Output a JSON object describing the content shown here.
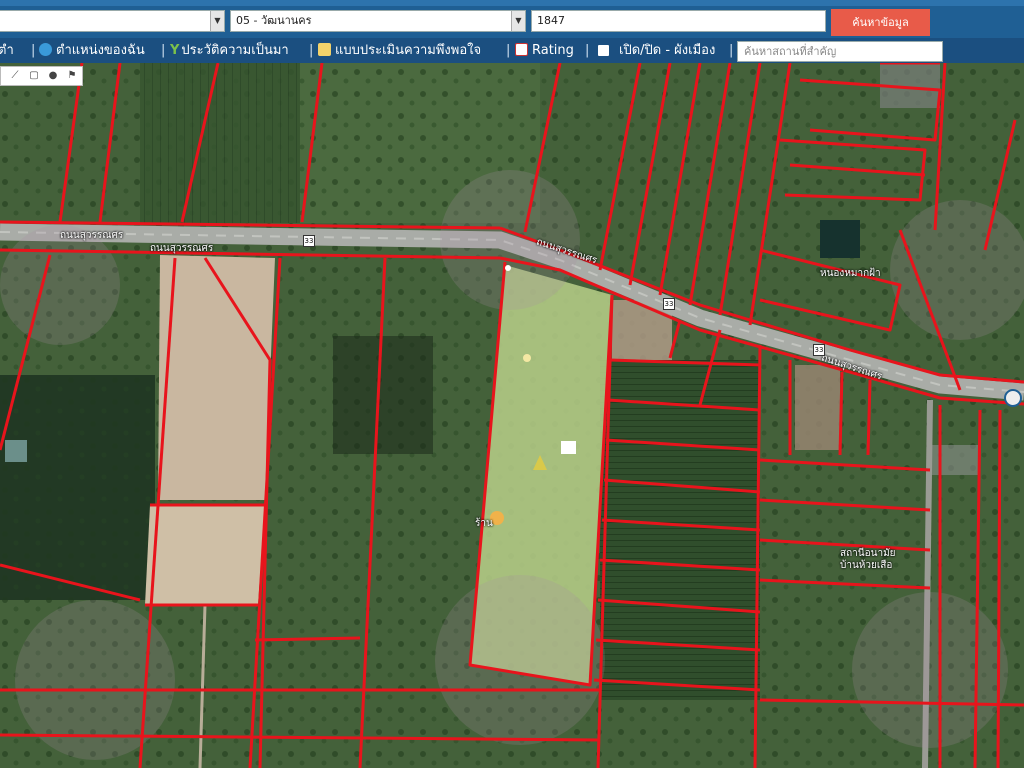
{
  "search": {
    "district_value": "",
    "subdistrict_value": "05 - วัฒนานคร",
    "parcel_value": "1847",
    "search_button": "ค้นหาข้อมูล"
  },
  "nav": {
    "item_home": "ตำ",
    "item_location": "ตำแหน่งของฉัน",
    "item_history": "ประวัติความเป็นมา",
    "item_survey": "แบบประเมินความพึงพอใจ",
    "item_rating": "Rating",
    "item_toggle": "เปิด/ปิด - ผังเมือง",
    "place_placeholder": "ค้นหาสถานที่สำคัญ"
  },
  "map": {
    "road_label_1": "ถนนสุวรรณศร",
    "road_label_2": "ถนนสุวรรณศร",
    "road_label_3": "ถนนสุวรรณศร",
    "road_number": "33",
    "place_label_1": "หนองหมากฝ้า",
    "place_label_2": "สถานีอนามัย บ้านห้วยเสือ",
    "place_label_3": "ร้าน"
  },
  "colors": {
    "parcel_line": "#e8141c",
    "highlight_parcel": "#b9d08a",
    "road": "#a9aca7",
    "nav_bg": "#1b4f80",
    "search_button": "#e85b49"
  }
}
